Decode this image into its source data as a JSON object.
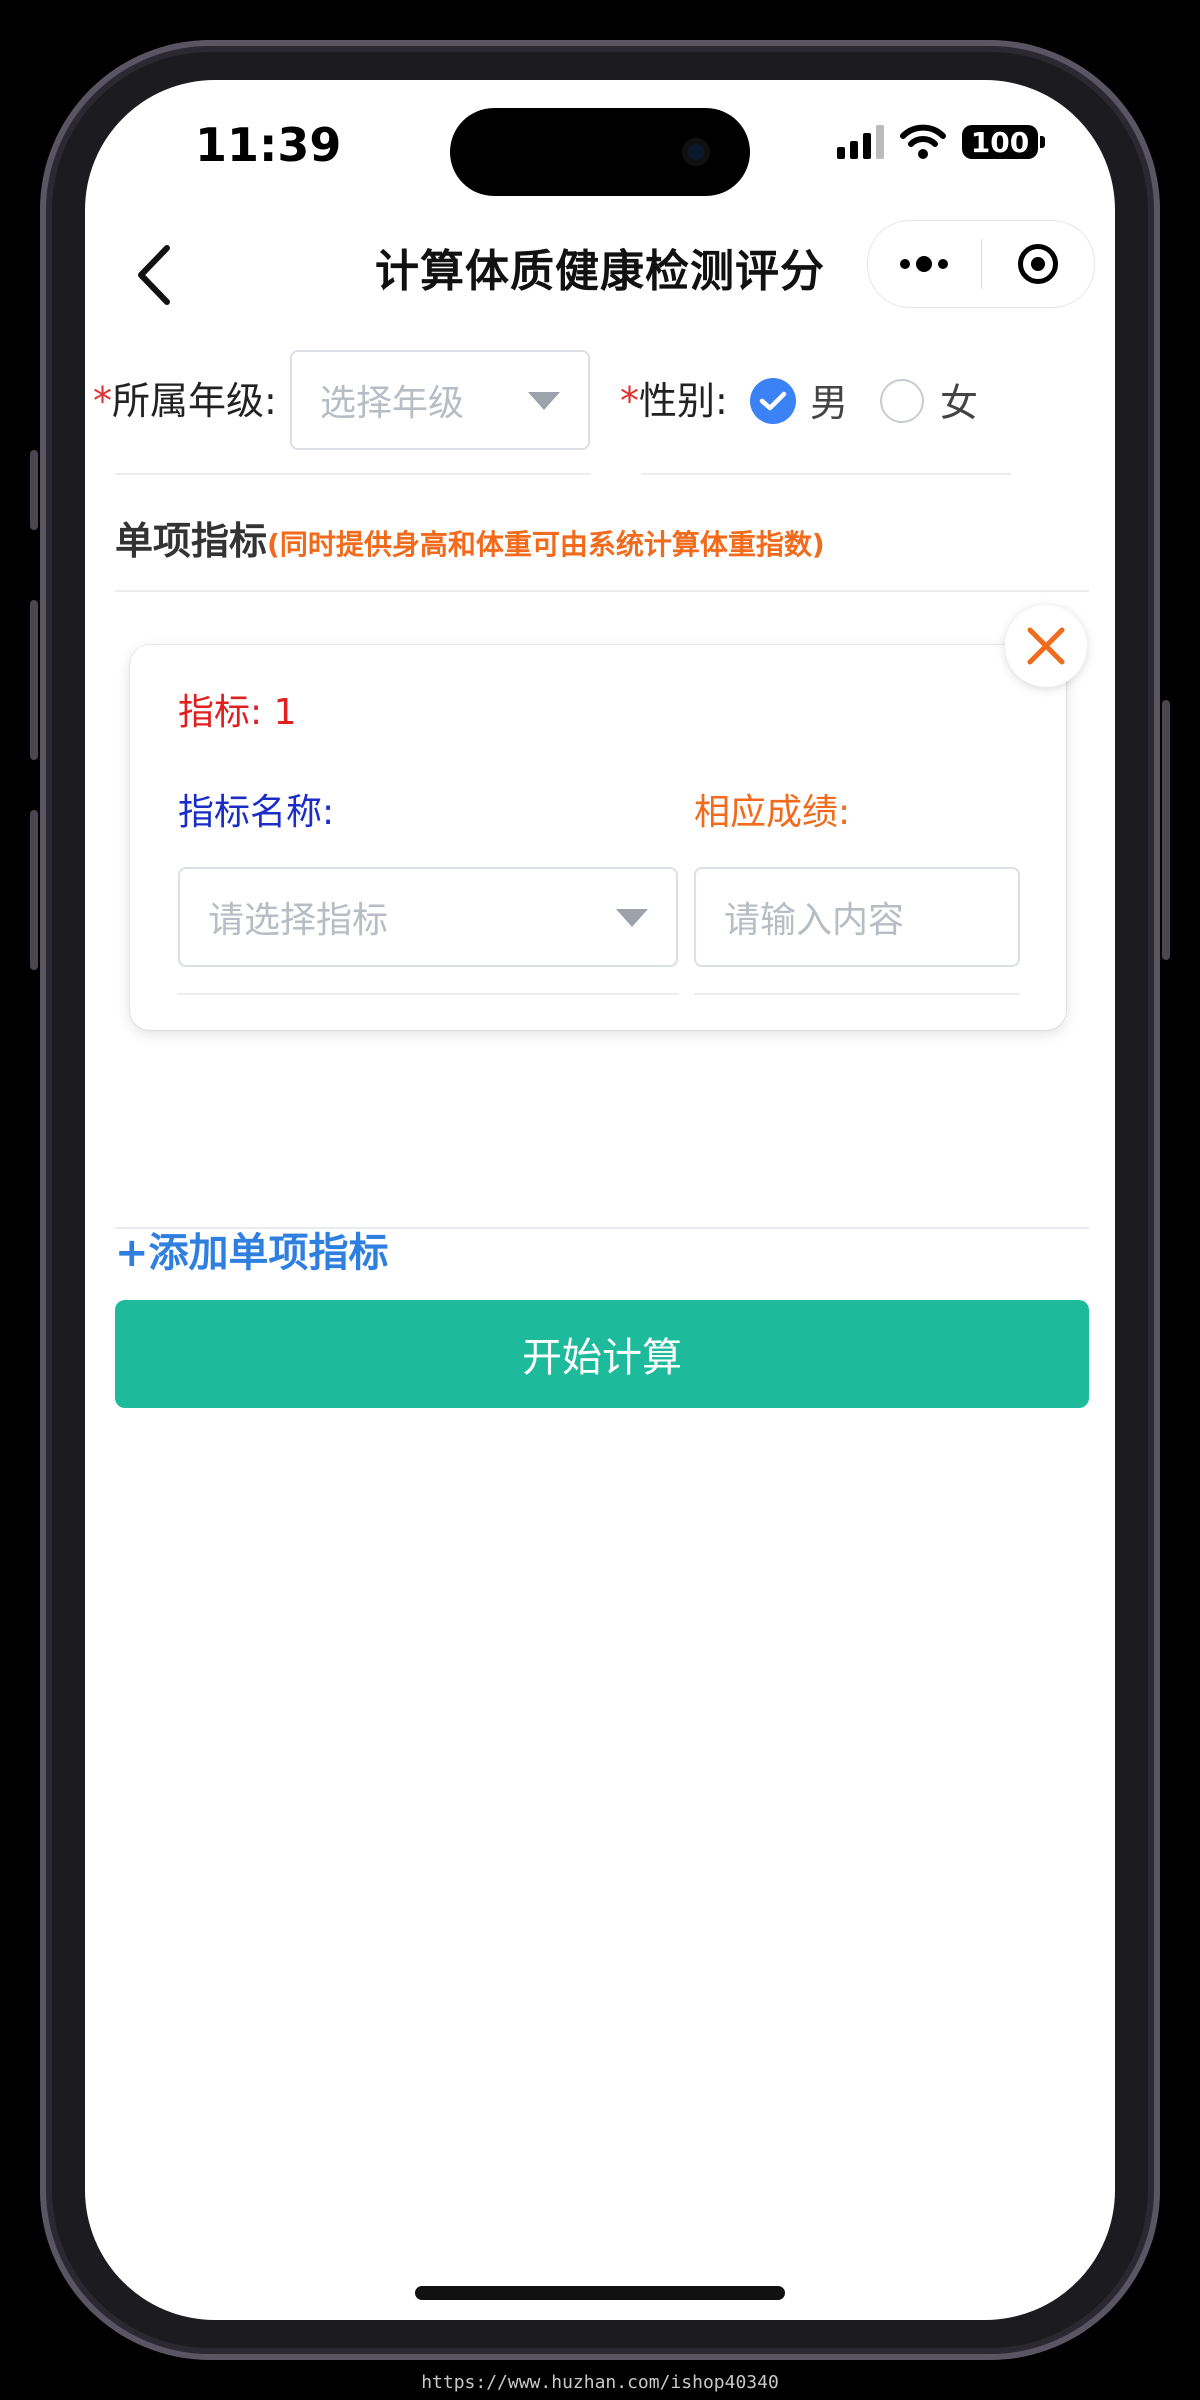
{
  "status_bar": {
    "time": "11:39",
    "battery": "100"
  },
  "nav": {
    "title": "计算体质健康检测评分"
  },
  "form": {
    "grade_label": "所属年级:",
    "grade_placeholder": "选择年级",
    "required_mark": "*",
    "gender_label": "性别:",
    "gender_options": [
      {
        "label": "男",
        "selected": true
      },
      {
        "label": "女",
        "selected": false
      }
    ]
  },
  "section": {
    "title": "单项指标",
    "note": "(同时提供身高和体重可由系统计算体重指数)"
  },
  "indicator_card": {
    "header": "指标: 1",
    "name_label": "指标名称:",
    "name_placeholder": "请选择指标",
    "score_label": "相应成绩:",
    "score_placeholder": "请输入内容"
  },
  "actions": {
    "add_label": "添加单项指标",
    "add_prefix": "+",
    "calculate_label": "开始计算"
  },
  "watermark": "https://www.huzhan.com/ishop40340",
  "colors": {
    "primary_button": "#1dbb9b",
    "link_blue": "#2f7fe0",
    "radio_blue": "#3b82f6",
    "note_orange": "#f26a1b",
    "required_red": "#e03030",
    "label_blue": "#1a2ec7"
  }
}
